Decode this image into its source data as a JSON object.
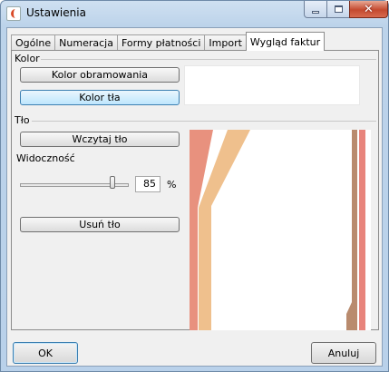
{
  "window": {
    "title": "Ustawienia"
  },
  "tabs": [
    {
      "label": "Ogólne",
      "active": false
    },
    {
      "label": "Numeracja",
      "active": false
    },
    {
      "label": "Formy płatności",
      "active": false
    },
    {
      "label": "Import",
      "active": false
    },
    {
      "label": "Wygląd faktur",
      "active": true
    }
  ],
  "kolor_section": {
    "label": "Kolor",
    "border_color_button": "Kolor obramowania",
    "background_color_button": "Kolor tła",
    "preview_color": "#ffffff"
  },
  "tlo_section": {
    "label": "Tło",
    "load_button": "Wczytaj tło",
    "visibility_label": "Widoczność",
    "visibility_value": "85",
    "visibility_unit": "%",
    "visibility_fraction": 0.85,
    "remove_button": "Usuń tło"
  },
  "preview": {
    "stripe_colors": [
      "#e8917e",
      "#efc08d",
      "#b98b6e",
      "#e8847c"
    ]
  },
  "footer": {
    "ok": "OK",
    "cancel": "Anuluj"
  }
}
